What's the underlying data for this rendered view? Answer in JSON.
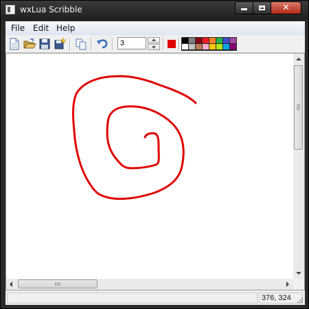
{
  "window": {
    "title": "wxLua Scribble",
    "close_glyph": "✕"
  },
  "menu": {
    "items": [
      "File",
      "Edit",
      "Help"
    ]
  },
  "toolbar": {
    "icons": [
      "new-file-icon",
      "open-folder-icon",
      "save-icon",
      "save-as-icon",
      "copy-icon",
      "undo-icon"
    ],
    "pen_size": "3",
    "current_color": "#e00000",
    "palette": [
      "#000000",
      "#7f7f7f",
      "#880015",
      "#ed1c24",
      "#ff7f27",
      "#22b14c",
      "#3f48cc",
      "#a349a4",
      "#ffffff",
      "#c3c3c3",
      "#b97a57",
      "#ffaec9",
      "#ffc90e",
      "#b5e61d",
      "#00a2e8",
      "#880079"
    ]
  },
  "canvas": {
    "stroke_color": "#e00000"
  },
  "status": {
    "left_text": "",
    "coords": "376, 324"
  }
}
